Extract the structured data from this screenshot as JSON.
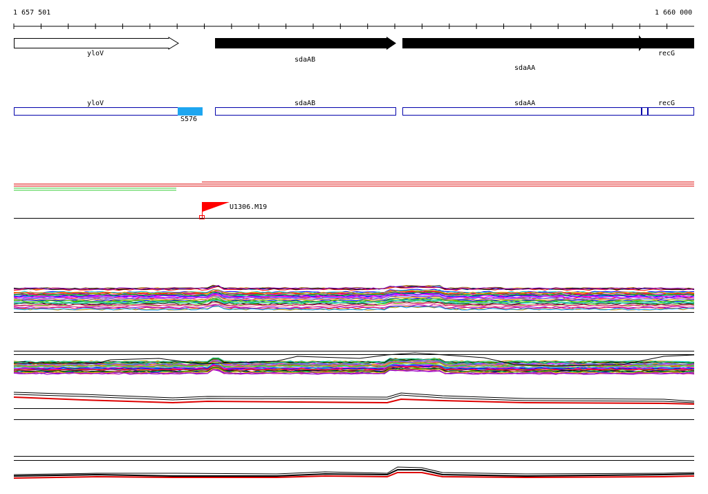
{
  "axis": {
    "start_label": "1 657 501",
    "end_label": "1 660 000"
  },
  "genes": [
    {
      "name": "yloV",
      "style": "hollow"
    },
    {
      "name": "sdaAB",
      "style": "filled"
    },
    {
      "name": "sdaAA",
      "style": "filled"
    },
    {
      "name": "recG",
      "style": "filled"
    }
  ],
  "segment_label": "S576",
  "feature_label": "U1306.M19",
  "colors": {
    "gene_box": "#0000aa",
    "segment": "#1ea6f0",
    "flag": "#ff0000",
    "green_tracks": "#33cc33",
    "red_tracks": "#dd0000"
  }
}
